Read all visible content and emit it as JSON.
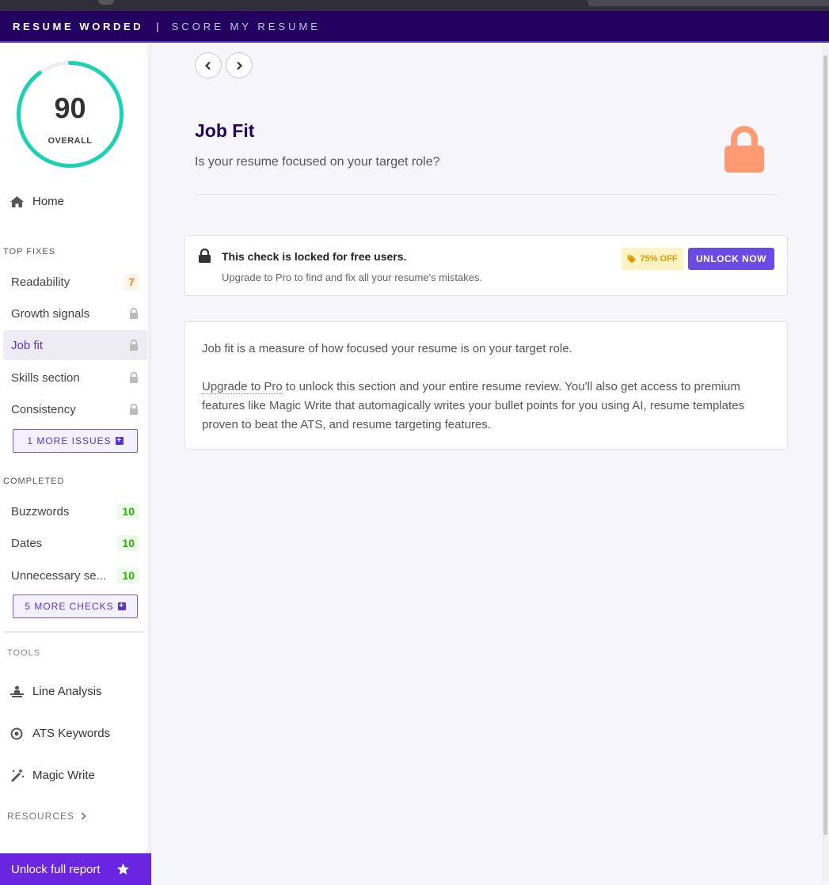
{
  "header": {
    "brand": "RESUME WORDED",
    "separator": "|",
    "product": "SCORE MY RESUME"
  },
  "score": {
    "value": "90",
    "label": "OVERALL",
    "percent": 90,
    "ring_color": "#1bd3b3"
  },
  "sidebar": {
    "home_label": "Home",
    "top_fixes_title": "TOP FIXES",
    "top_fixes": [
      {
        "label": "Readability",
        "value": "7"
      },
      {
        "label": "Growth signals",
        "locked": true
      },
      {
        "label": "Job fit",
        "locked": true,
        "active": true
      },
      {
        "label": "Skills section",
        "locked": true
      },
      {
        "label": "Consistency",
        "locked": true
      }
    ],
    "more_issues_label": "1 MORE ISSUES",
    "completed_title": "COMPLETED",
    "completed": [
      {
        "label": "Buzzwords",
        "value": "10"
      },
      {
        "label": "Dates",
        "value": "10"
      },
      {
        "label": "Unnecessary se...",
        "value": "10"
      }
    ],
    "more_checks_label": "5 MORE CHECKS",
    "tools_title": "TOOLS",
    "tools": [
      {
        "label": "Line Analysis",
        "icon": "line-analysis-icon"
      },
      {
        "label": "ATS Keywords",
        "icon": "target-icon"
      },
      {
        "label": "Magic Write",
        "icon": "magic-wand-icon"
      }
    ],
    "resources_label": "RESOURCES",
    "unlock_full_label": "Unlock full report"
  },
  "main": {
    "title": "Job Fit",
    "subtitle": "Is your resume focused on your target role?",
    "lock_card": {
      "title": "This check is locked for free users.",
      "subtitle": "Upgrade to Pro to find and fix all your resume's mistakes.",
      "discount_label": "75% OFF",
      "button_label": "UNLOCK NOW"
    },
    "info": {
      "paragraph1": "Job fit is a measure of how focused your resume is on your target role.",
      "link_label": "Upgrade to Pro",
      "paragraph2_rest": " to unlock this section and your entire resume review. You'll also get access to premium features like Magic Write that automagically writes your bullet points for you using AI, resume templates proven to beat the ATS, and resume targeting features."
    }
  },
  "colors": {
    "header_bg": "#23005f",
    "accent": "#6b4ae6",
    "lock_orange": "#ff9a73",
    "green": "#27b500",
    "orange": "#f08a24"
  }
}
